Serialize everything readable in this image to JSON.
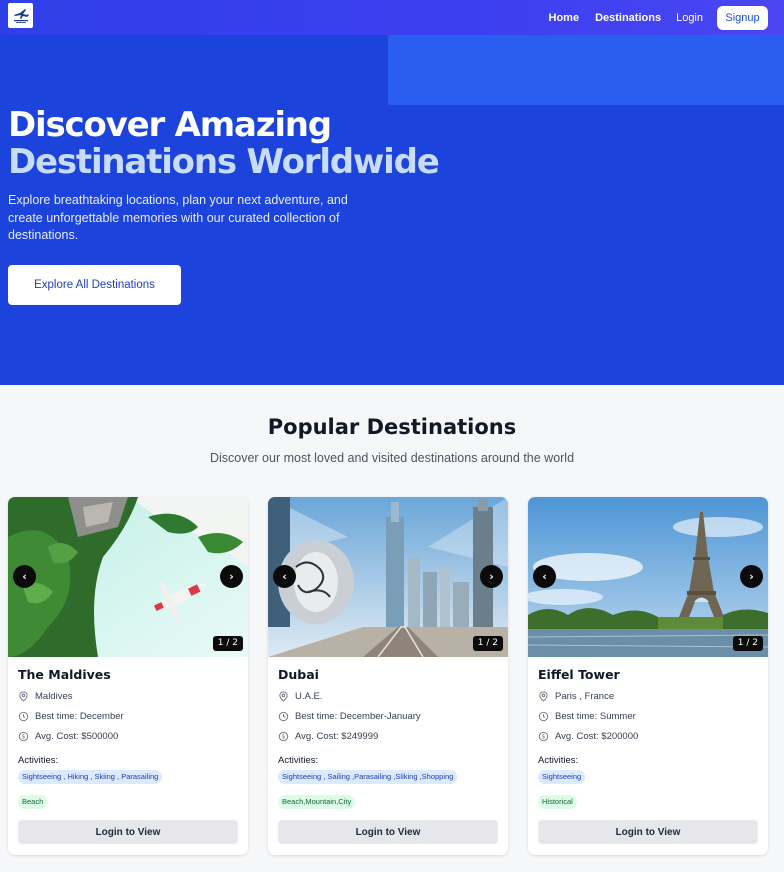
{
  "navbar": {
    "logo_icon": "airplane-logo-icon",
    "links": [
      "Home",
      "Destinations"
    ],
    "login": "Login",
    "signup": "Signup"
  },
  "hero": {
    "title_line1": "Discover Amazing",
    "title_line2": "Destinations Worldwide",
    "subtitle": "Explore breathtaking locations, plan your next adventure, and create unforgettable memories with our curated collection of destinations.",
    "cta": "Explore All Destinations"
  },
  "popular": {
    "title": "Popular Destinations",
    "subtitle": "Discover our most loved and visited destinations around the world",
    "cards": [
      {
        "name": "The Maldives",
        "location": "Maldives",
        "best_time": "Best time: December",
        "cost": "Avg. Cost: $500000",
        "activities_label": "Activities:",
        "activities": "Sightseeing , Hiking , Skiing , Parasailing",
        "type": "Beach",
        "counter": "1 / 2",
        "button": "Login to View"
      },
      {
        "name": "Dubai",
        "location": "U.A.E.",
        "best_time": "Best time: December-January",
        "cost": "Avg. Cost: $249999",
        "activities_label": "Activities:",
        "activities": "Sightseeing , Sailing ,Parasailing ,Sliking ,Shopping",
        "type": "Beach,Mountain,City",
        "counter": "1 / 2",
        "button": "Login to View"
      },
      {
        "name": "Eiffel Tower",
        "location": "Paris , France",
        "best_time": "Best time: Summer",
        "cost": "Avg. Cost: $200000",
        "activities_label": "Activities:",
        "activities": "Sightseeing",
        "type": "Historical",
        "counter": "1 / 2",
        "button": "Login to View"
      }
    ]
  },
  "colors": {
    "nav_bg": "#3b3fee",
    "hero_bg": "#1c44dc",
    "hero_title_accent": "#c7dcfb",
    "activity_chip": "#dbeafe",
    "type_chip": "#dcfce7"
  },
  "icons": {
    "location": "map-pin-icon",
    "time": "clock-icon",
    "cost": "dollar-circle-icon",
    "prev": "chevron-left-icon",
    "next": "chevron-right-icon"
  }
}
